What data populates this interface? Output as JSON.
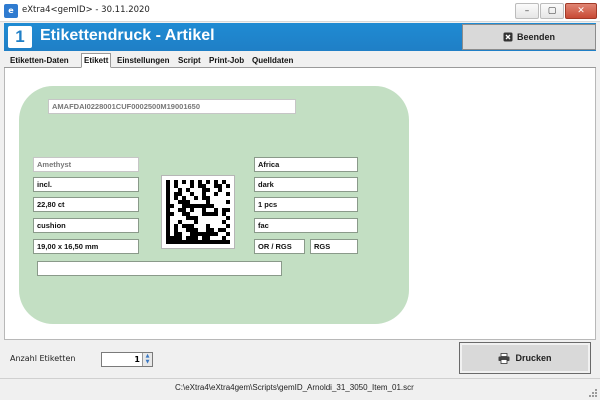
{
  "window": {
    "title": "eXtra4<gemID>  -  30.11.2020",
    "icon_label": "e",
    "controls": {
      "minimize": "–",
      "maximize": "▢",
      "close": "✕"
    }
  },
  "header": {
    "badge": "1",
    "title": "Etikettendruck - Artikel",
    "exit_button": "Beenden",
    "exit_icon": "close-box-icon"
  },
  "tabs": [
    {
      "label": "Etiketten-Daten",
      "active": false
    },
    {
      "label": "Etikett",
      "active": true
    },
    {
      "label": "Einstellungen",
      "active": false
    },
    {
      "label": "Script",
      "active": false
    },
    {
      "label": "Print-Job",
      "active": false
    },
    {
      "label": "Quelldaten",
      "active": false
    }
  ],
  "label": {
    "code": "AMAFDAI0228001CUF0002500M19001650",
    "left_fields": [
      "Amethyst",
      "incl.",
      "22,80 ct",
      "cushion",
      "19,00 x 16,50 mm"
    ],
    "right_fields": [
      "Africa",
      "dark",
      "1 pcs",
      "fac"
    ],
    "treatment_fields": [
      "OR / RGS",
      "RGS"
    ],
    "bottom_field": ""
  },
  "footer": {
    "count_label": "Anzahl Etiketten",
    "count_value": "1",
    "print_button": "Drucken",
    "print_icon": "printer-icon"
  },
  "status": {
    "path": "C:\\eXtra4\\eXtra4gem\\Scripts\\gemID_Arnoldi_31_3050_Item_01.scr"
  }
}
